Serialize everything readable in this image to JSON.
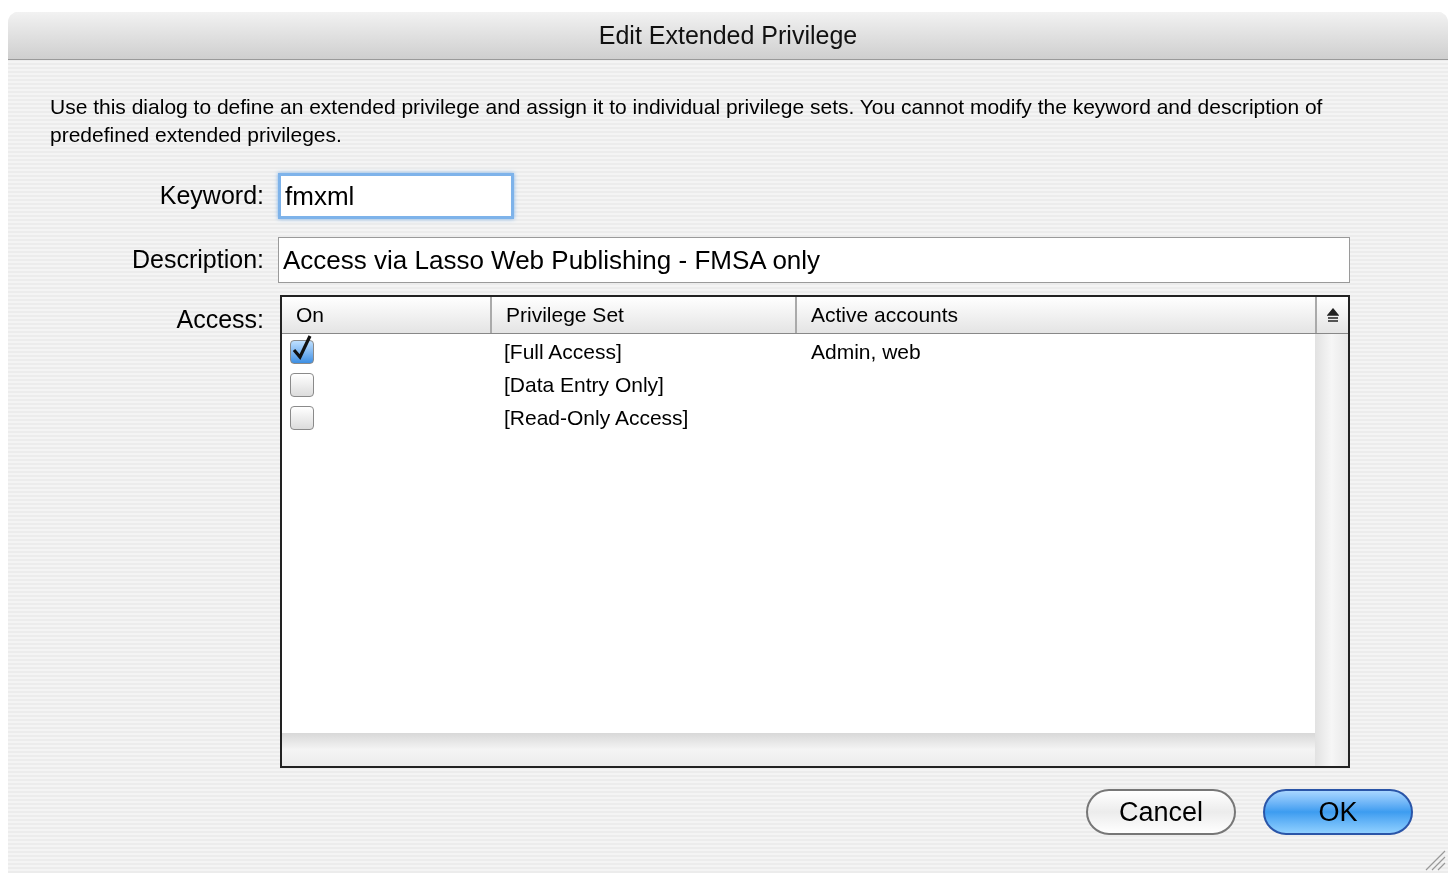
{
  "window": {
    "title": "Edit Extended Privilege"
  },
  "intro": "Use this dialog to define an extended privilege and assign it to individual privilege sets. You cannot modify the keyword and description of predefined extended privileges.",
  "keyword": {
    "label": "Keyword:",
    "value": "fmxml",
    "focused": true
  },
  "description": {
    "label": "Description:",
    "value": "Access via Lasso Web Publishing - FMSA only"
  },
  "access": {
    "label": "Access:",
    "columns": [
      "On",
      "Privilege Set",
      "Active accounts"
    ],
    "rows": [
      {
        "checked": true,
        "privilege_set": "[Full Access]",
        "active_accounts": "Admin, web"
      },
      {
        "checked": false,
        "privilege_set": "[Data Entry Only]"
      },
      {
        "checked": false,
        "privilege_set": "[Read-Only Access]"
      }
    ]
  },
  "buttons": [
    {
      "label": "Cancel",
      "default": false
    },
    {
      "label": "OK",
      "default": true
    }
  ]
}
